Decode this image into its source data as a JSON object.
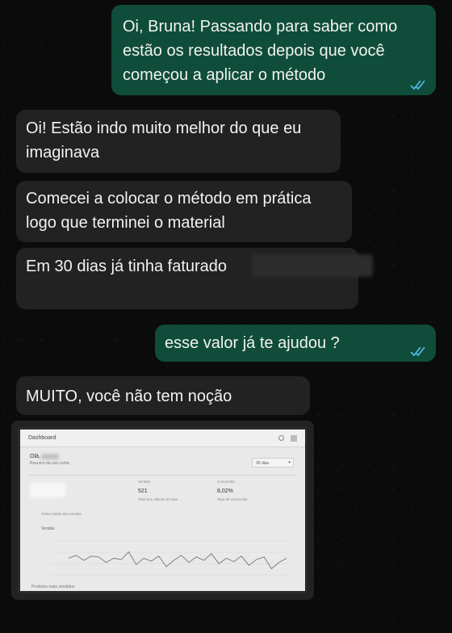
{
  "messages": [
    {
      "direction": "outgoing",
      "text": "Oi, Bruna! Passando para saber como estão os resultados depois que você começou a aplicar o método",
      "status": "read"
    },
    {
      "direction": "incoming",
      "text": "Oi! Estão indo muito melhor do que eu imaginava"
    },
    {
      "direction": "incoming",
      "text": "Comecei a colocar o método em prática logo que terminei o material"
    },
    {
      "direction": "incoming",
      "text": "Em 30 dias já tinha faturado"
    },
    {
      "direction": "outgoing",
      "text": "esse valor já te ajudou ?",
      "status": "read"
    },
    {
      "direction": "incoming",
      "text": "MUITO, você não tem noção"
    }
  ],
  "dashboard": {
    "title": "Dashboard",
    "greeting": "Olá,",
    "greeting_sub": "Resumo da sua conta",
    "range": "30 dias",
    "col2_label": "Vendas",
    "col2_value": "521",
    "col2_sub": "Total dos últimos 30 dias",
    "col3_label": "Conversão",
    "col3_value": "8,02%",
    "col3_sub": "Taxa de conversão",
    "ticket_label": "Ticket médio das vendas",
    "section_label": "Vendas",
    "bottom_label": "Produtos mais vendidos",
    "chart_series": [
      0.55,
      0.62,
      0.5,
      0.6,
      0.58,
      0.45,
      0.55,
      0.52,
      0.7,
      0.4,
      0.55,
      0.48,
      0.6,
      0.35,
      0.5,
      0.62,
      0.45,
      0.58,
      0.5,
      0.66,
      0.42,
      0.55,
      0.47,
      0.6,
      0.38,
      0.52,
      0.58,
      0.3,
      0.45,
      0.55
    ]
  },
  "colors": {
    "outgoing_bubble": "#0f4d3a",
    "incoming_bubble": "#222222",
    "read_ticks": "#53bdeb"
  }
}
